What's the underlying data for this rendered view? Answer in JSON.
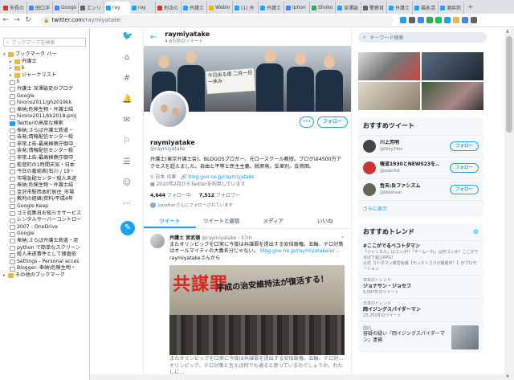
{
  "browser": {
    "tabs": [
      {
        "label": "市長の",
        "color": "#d93025",
        "active": false
      },
      {
        "label": "田口洋",
        "color": "#4285f4",
        "active": false
      },
      {
        "label": "Google",
        "color": "#4285f4",
        "active": false
      },
      {
        "label": "エンリッ",
        "color": "#5f6368",
        "active": false
      },
      {
        "label": "ray",
        "color": "#1da1f2",
        "active": true
      },
      {
        "label": "ray",
        "color": "#1da1f2",
        "active": false
      },
      {
        "label": "刑法の",
        "color": "#d93025",
        "active": false
      },
      {
        "label": "弁護士",
        "color": "#1da1f2",
        "active": false
      },
      {
        "label": "Weblo",
        "color": "#f4b400",
        "active": false
      },
      {
        "label": "(1) 弁",
        "color": "#1da1f2",
        "active": false
      },
      {
        "label": "弁護士",
        "color": "#1da1f2",
        "active": false
      },
      {
        "label": "iphon",
        "color": "#4285f4",
        "active": false
      },
      {
        "label": "Shoko",
        "color": "#34a853",
        "active": false
      },
      {
        "label": "深澤諭",
        "color": "#1da1f2",
        "active": false
      },
      {
        "label": "警察官",
        "color": "#5f6368",
        "active": false
      },
      {
        "label": "弁護士",
        "color": "#1da1f2",
        "active": false
      },
      {
        "label": "福永活",
        "color": "#1da1f2",
        "active": false
      },
      {
        "label": "酒井邦",
        "color": "#1da1f2",
        "active": false
      }
    ],
    "new_tab": "+",
    "back": "←",
    "forward": "→",
    "reload": "↻",
    "url_host": "twitter.com",
    "url_path": "/raymiyatake",
    "lock": "🔒"
  },
  "bookmarks": {
    "search_placeholder": "ブックマークを検索",
    "search_icon": "search-icon",
    "items": [
      {
        "label": "ブックマーク バー",
        "type": "folder",
        "depth": 0,
        "open": true
      },
      {
        "label": "弁護士",
        "type": "folder",
        "depth": 1
      },
      {
        "label": "k",
        "type": "folder",
        "depth": 1
      },
      {
        "label": "ジャーナリスト",
        "type": "folder",
        "depth": 1
      },
      {
        "label": "k",
        "type": "page",
        "depth": 1
      },
      {
        "label": "弁護士 深澤諭史のブログ",
        "type": "page",
        "depth": 1
      },
      {
        "label": "Google",
        "type": "page",
        "depth": 1
      },
      {
        "label": "hirono2011/gh2019kk",
        "type": "page",
        "depth": 1
      },
      {
        "label": "奉納;危険生物・弁護士結",
        "type": "page",
        "depth": 1
      },
      {
        "label": "hirono2011/kk2018-proj",
        "type": "page",
        "depth": 1
      },
      {
        "label": "Twitterの高度な検索",
        "type": "tw",
        "depth": 1
      },
      {
        "label": "奉納;さらば弁護士鉄道・",
        "type": "page",
        "depth": 1
      },
      {
        "label": "告発;情報配信センター殺",
        "type": "page",
        "depth": 1
      },
      {
        "label": "非常上告-最高検察庁御中_",
        "type": "page",
        "depth": 1
      },
      {
        "label": "告発;情報配信センター殺",
        "type": "page",
        "depth": 1
      },
      {
        "label": "非常上告-最高検察庁御中_",
        "type": "page",
        "depth": 1
      },
      {
        "label": "能登町の1時間天気・日本",
        "type": "page",
        "depth": 1
      },
      {
        "label": "今日の番組表[石川 / 19・",
        "type": "page",
        "depth": 1
      },
      {
        "label": "市場急配センター殺人未遂",
        "type": "page",
        "depth": 1
      },
      {
        "label": "奉納;危険生物・弁護士結",
        "type": "page",
        "depth": 1
      },
      {
        "label": "金沢市駅西本町居住_市場",
        "type": "page",
        "depth": 1
      },
      {
        "label": "教判の経緯/資料/平成4年",
        "type": "page",
        "depth": 1
      },
      {
        "label": "Google Keep",
        "type": "page",
        "depth": 1
      },
      {
        "label": "ゴミ収集日お知らせサービス",
        "type": "page",
        "depth": 1
      },
      {
        "label": "レンタルサーバーコントロー",
        "type": "page",
        "depth": 1
      },
      {
        "label": "2007 - OneDrive",
        "type": "page",
        "depth": 1
      },
      {
        "label": "Google",
        "type": "page",
        "depth": 1
      },
      {
        "label": "奉納;さらば弁護士鉄道・泥",
        "type": "page",
        "depth": 1
      },
      {
        "label": "python で簡単なスクリーン",
        "type": "page",
        "depth": 1
      },
      {
        "label": "殺人未遂事件として捜査依",
        "type": "page",
        "depth": 1
      },
      {
        "label": "Settings - Personal acces",
        "type": "page",
        "depth": 1
      },
      {
        "label": "Blogger: 奉納\\危険生物・",
        "type": "page",
        "depth": 1
      },
      {
        "label": "その他のブックマーク",
        "type": "folder",
        "depth": 0
      }
    ]
  },
  "nav": {
    "icons": [
      "twitter-bird-icon",
      "home-icon",
      "hashtag-icon",
      "bell-icon",
      "mail-icon",
      "bookmark-icon",
      "list-icon",
      "profile-icon",
      "more-icon"
    ],
    "compose": "compose-icon"
  },
  "profile": {
    "header_name": "raymiyatake",
    "header_count": "4.8万件のツイート",
    "sign_text": "今日出る道 二月一日一休み",
    "more_label": "•••",
    "follow_label": "フォロー",
    "display_name": "raymiyatake",
    "handle": "@raymiyatake",
    "bio": "弁護士(東京弁護士会)、BLOGOSブロガー、元ロースクール教授。ブログは4500万アクセスを超えました。自由と平等と民主主義。脱原発。反差別。反貧困。",
    "location": "日本 兵庫",
    "link": "blog.goo.ne.jp/raymiyatake",
    "joined": "2010年2月からTwitterを利用しています",
    "following_count": "4,644",
    "following_label": "フォロー中",
    "followers_count": "7,512",
    "followers_label": "フォロワー",
    "followed_by": "Janetterさんにフォローされています",
    "tabs": [
      "ツイート",
      "ツイートと返信",
      "メディア",
      "いいね"
    ]
  },
  "tweet": {
    "name": "弁護士 宮武嶺",
    "handle": "@raymiyatake · 57m",
    "chevron": "⌄",
    "text": "またオリンピックを口実に今度は共謀罪を提出する安倍政権。五輪、テロ対策はオールマイティの大義名分じゃない。",
    "link": "blog.goo.ne.jp/raymiyatake/e/...",
    "via": " raymiyatakeさんから",
    "image_title": "共謀罪",
    "image_subtitle": "平成の治安維持法が復活する！",
    "image_caption": "またオリンピックを口実に今度は共謀罪を提出する安倍政権。五輪、テロ対…",
    "image_caption2": "オリンピック、テロ対策と言えば何でも通ると思っているのでしょうか。わたしに…"
  },
  "right": {
    "search_placeholder": "キーワード検索",
    "wtf_title": "おすすめツイート",
    "wtf": [
      {
        "name": "川上芳明",
        "handle": "@Only1Yori",
        "color": "#444"
      },
      {
        "name": "報道1930とNEWS23を…",
        "handle": "@ouenhst",
        "color": "#c33"
      },
      {
        "name": "哲夫:反ファシズム",
        "handle": "@bbtetsuo",
        "color": "#665"
      }
    ],
    "follow_label": "フォロー",
    "more": "さらに表示",
    "trends_title": "おすすめトレンド",
    "gear": "⚙",
    "trends": [
      {
        "title": "#ここがでるべコトダマン",
        "sub": "「ジャッカル」はコンボ!!「チーム一丸」は何コンボ？ここがでるぽで遊ぶRPG!"
      },
      {
        "title": "",
        "sub": "公式 コトダマン運営会議【モンストコラボ開催中！】がプロモーション"
      },
      {
        "title": "ジョナサン・ジョセフ",
        "sub": "5,097件のツイート",
        "top": "日本のトレンド"
      },
      {
        "title": "岡イジングスパイダーマン",
        "sub": "23,251件のツイート",
        "top": "日本のトレンド"
      }
    ],
    "last_top": "国内",
    "last_text": "容疑の疑い『岡イジングスパイダーマン』逮捕"
  }
}
